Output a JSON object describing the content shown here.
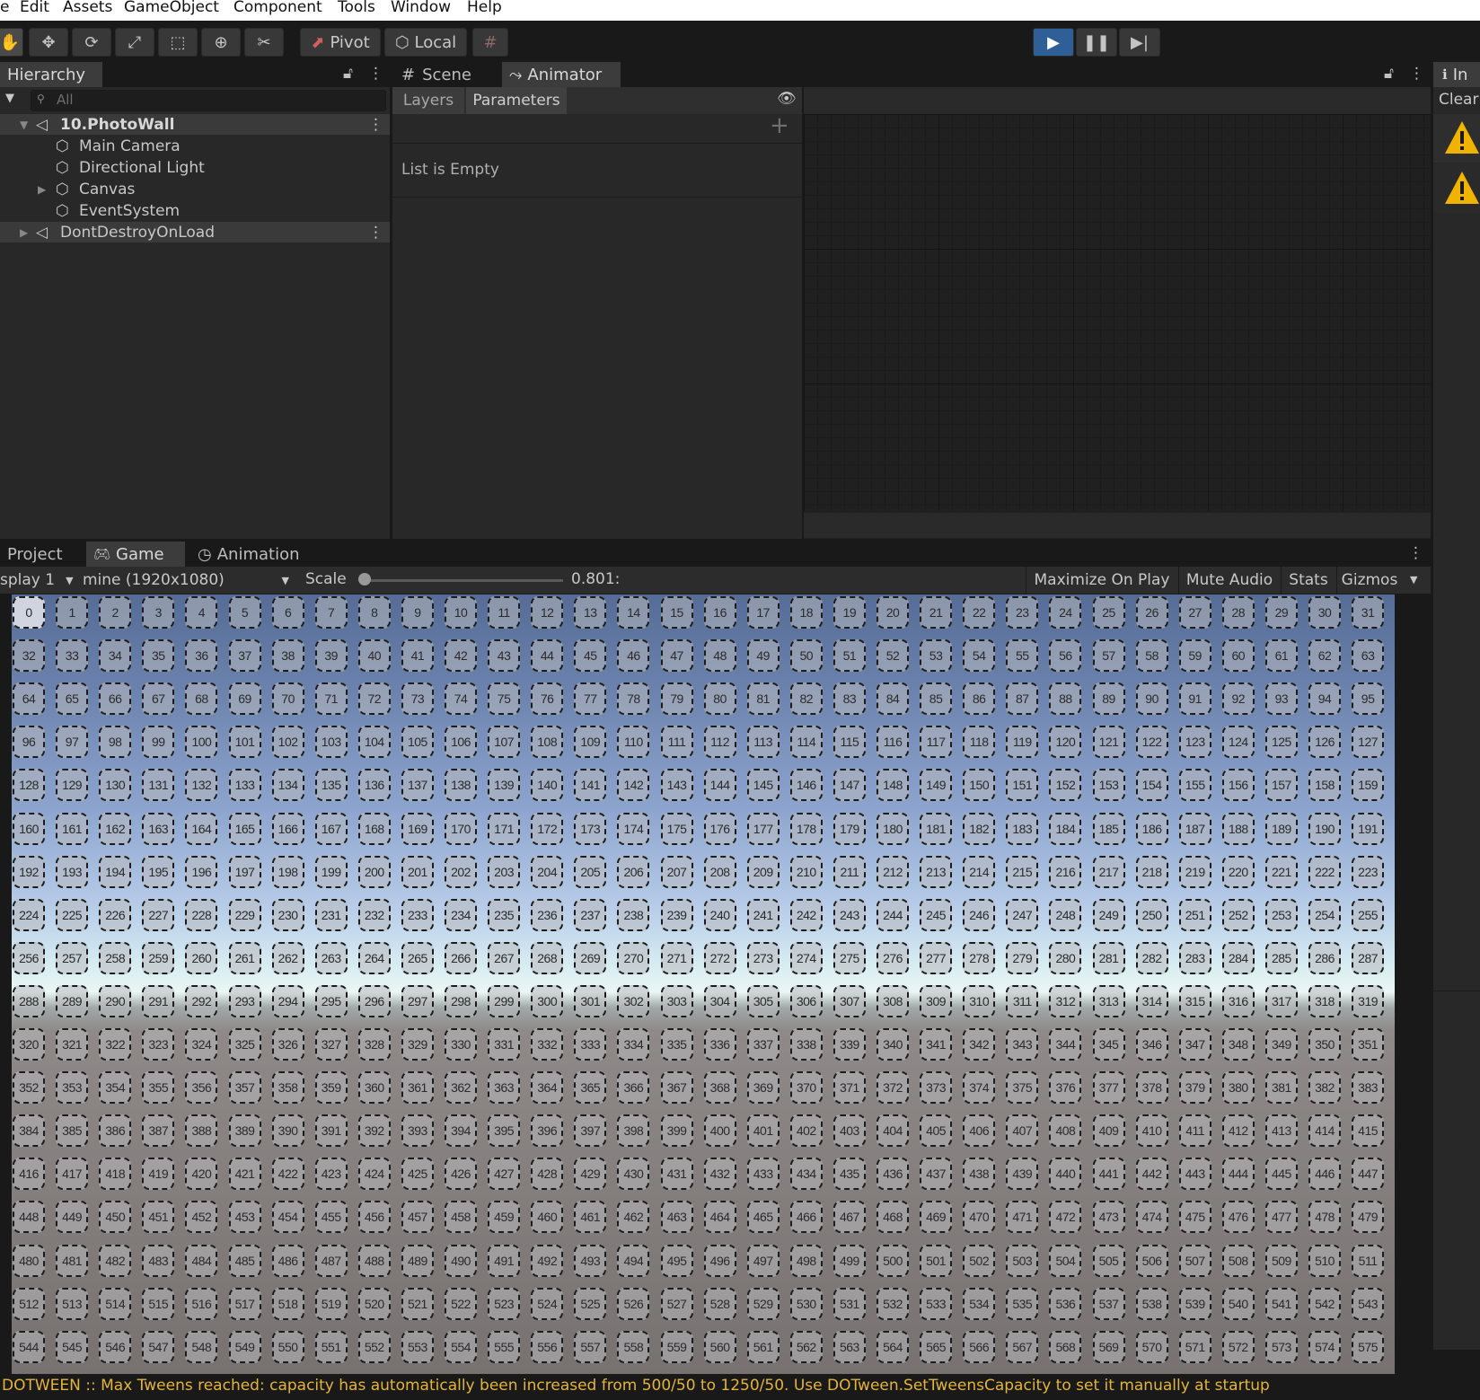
{
  "menu": [
    "e",
    "Edit",
    "Assets",
    "GameObject",
    "Component",
    "Tools",
    "Window",
    "Help"
  ],
  "toolbar": {
    "tools": [
      "hand-tool-icon",
      "move-tool-icon",
      "rotate-tool-icon",
      "scale-tool-icon",
      "rect-tool-icon",
      "transform-tool-icon",
      "custom-tool-icon"
    ],
    "pivot_label": "Pivot",
    "local_label": "Local",
    "play_state": "playing"
  },
  "hierarchy": {
    "title": "Hierarchy",
    "search_placeholder": "All",
    "items": [
      {
        "label": "10.PhotoWall",
        "type": "scene"
      },
      {
        "label": "Main Camera",
        "type": "object"
      },
      {
        "label": "Directional Light",
        "type": "object"
      },
      {
        "label": "Canvas",
        "type": "object"
      },
      {
        "label": "EventSystem",
        "type": "object"
      },
      {
        "label": "DontDestroyOnLoad",
        "type": "scene"
      }
    ]
  },
  "center": {
    "tabs": [
      "Scene",
      "Animator"
    ],
    "subtabs": [
      "Layers",
      "Parameters"
    ],
    "empty_text": "List is Empty"
  },
  "inspector": {
    "tab_label": "In",
    "clear_label": "Clear"
  },
  "bottom": {
    "tabs": [
      "Project",
      "Game",
      "Animation"
    ],
    "display": "splay 1",
    "resolution": "mine (1920x1080)",
    "scale_label": "Scale",
    "scale_value": "0.801:",
    "scale_fraction": 0.0,
    "maximize_label": "Maximize On Play",
    "mute_label": "Mute Audio",
    "stats_label": "Stats",
    "gizmos_label": "Gizmos"
  },
  "grid": {
    "count": 576,
    "columns": 32
  },
  "status": {
    "message": "DOTWEEN :: Max Tweens reached: capacity has automatically been increased from 500/50 to 1250/50. Use DOTween.SetTweensCapacity to set it manually at startup",
    "color": "#e4b43a"
  },
  "colors": {
    "accent": "#2f5f97",
    "warning": "#f0b400"
  }
}
